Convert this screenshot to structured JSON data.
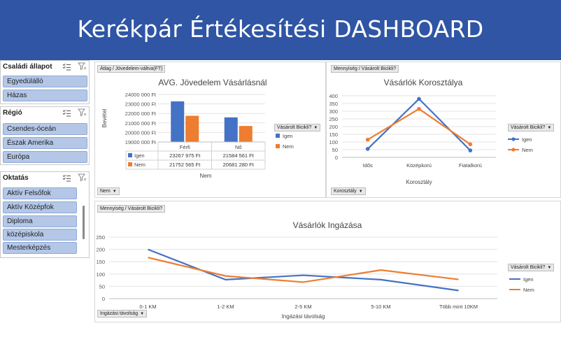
{
  "title": "Kerékpár Értékesítési DASHBOARD",
  "colors": {
    "igen": "#4472c4",
    "nem": "#ed7d31",
    "banner": "#2f55a4",
    "slicer_button": "#b4c7e7"
  },
  "slicers": {
    "csaladi": {
      "title": "Családi állapot",
      "items": [
        "Egyedülálló",
        "Házas"
      ]
    },
    "regio": {
      "title": "Régió",
      "items": [
        "Csendes-óceán",
        "Észak Amerika",
        "Európa"
      ]
    },
    "oktatas": {
      "title": "Oktatás",
      "items": [
        "Aktív Felsőfok",
        "Aktív Középfok",
        "Diploma",
        "középiskola",
        "Mesterképzés"
      ]
    },
    "icons": [
      "multi-select-icon",
      "clear-filter-icon"
    ]
  },
  "chart_income": {
    "value_button": "Átlag / Jövedelem-váltva(FT)",
    "axis_button": "Nem",
    "legend_button": "Vásárolt Bicikli?",
    "chart_data": {
      "type": "bar",
      "title": "AVG. Jövedelem Vásárlásnál",
      "categories": [
        "Férfi",
        "Nő"
      ],
      "series": [
        {
          "name": "Igen",
          "values": [
            23267975,
            21584561
          ]
        },
        {
          "name": "Nem",
          "values": [
            21752565,
            20681280
          ]
        }
      ],
      "table": {
        "Igen": [
          "23267 975 Ft",
          "21584 561 Ft"
        ],
        "Nem": [
          "21752 565 Ft",
          "20681 280 Ft"
        ]
      },
      "ylabel": "Bevétel",
      "xlabel": "Nem",
      "ylim": [
        19000000,
        24000000
      ],
      "yticks": [
        "24000 000 Ft",
        "23000 000 Ft",
        "22000 000 Ft",
        "21000 000 Ft",
        "20000 000 Ft",
        "19000 000 Ft"
      ],
      "legend": [
        "Igen",
        "Nem"
      ],
      "legend_position": "right",
      "grid": true
    }
  },
  "chart_age": {
    "value_button": "Mennyiség / Vásárolt Bicikli?",
    "axis_button": "Korosztály",
    "legend_button": "Vásárolt Bicikli?",
    "chart_data": {
      "type": "line",
      "title": "Vásárlók Korosztálya",
      "categories": [
        "Idős",
        "Középkorú",
        "Fiatalkorú"
      ],
      "series": [
        {
          "name": "Igen",
          "values": [
            55,
            380,
            45
          ]
        },
        {
          "name": "Nem",
          "values": [
            115,
            315,
            85
          ]
        }
      ],
      "xlabel": "Korosztály",
      "ylim": [
        0,
        400
      ],
      "yticks": [
        "400",
        "350",
        "300",
        "250",
        "200",
        "150",
        "100",
        "50",
        "0"
      ],
      "legend": [
        "Igen",
        "Nem"
      ],
      "legend_position": "right",
      "grid": true
    }
  },
  "chart_commute": {
    "value_button": "Mennyiség / Vásárolt Bicikli?",
    "axis_button": "Ingázási távolság",
    "legend_button": "Vásárolt Bicikli?",
    "chart_data": {
      "type": "line",
      "title": "Vásárlók Ingázása",
      "categories": [
        "0-1 KM",
        "1-2 KM",
        "2-5 KM",
        "5-10 KM",
        "Több mint 10KM"
      ],
      "series": [
        {
          "name": "Igen",
          "values": [
            200,
            77,
            95,
            77,
            33
          ]
        },
        {
          "name": "Nem",
          "values": [
            167,
            92,
            67,
            116,
            78
          ]
        }
      ],
      "xlabel": "Ingázási távolság",
      "ylim": [
        0,
        250
      ],
      "yticks": [
        "250",
        "200",
        "150",
        "100",
        "50",
        "0"
      ],
      "legend": [
        "Igen",
        "Nem"
      ],
      "legend_position": "right",
      "grid": true
    }
  }
}
